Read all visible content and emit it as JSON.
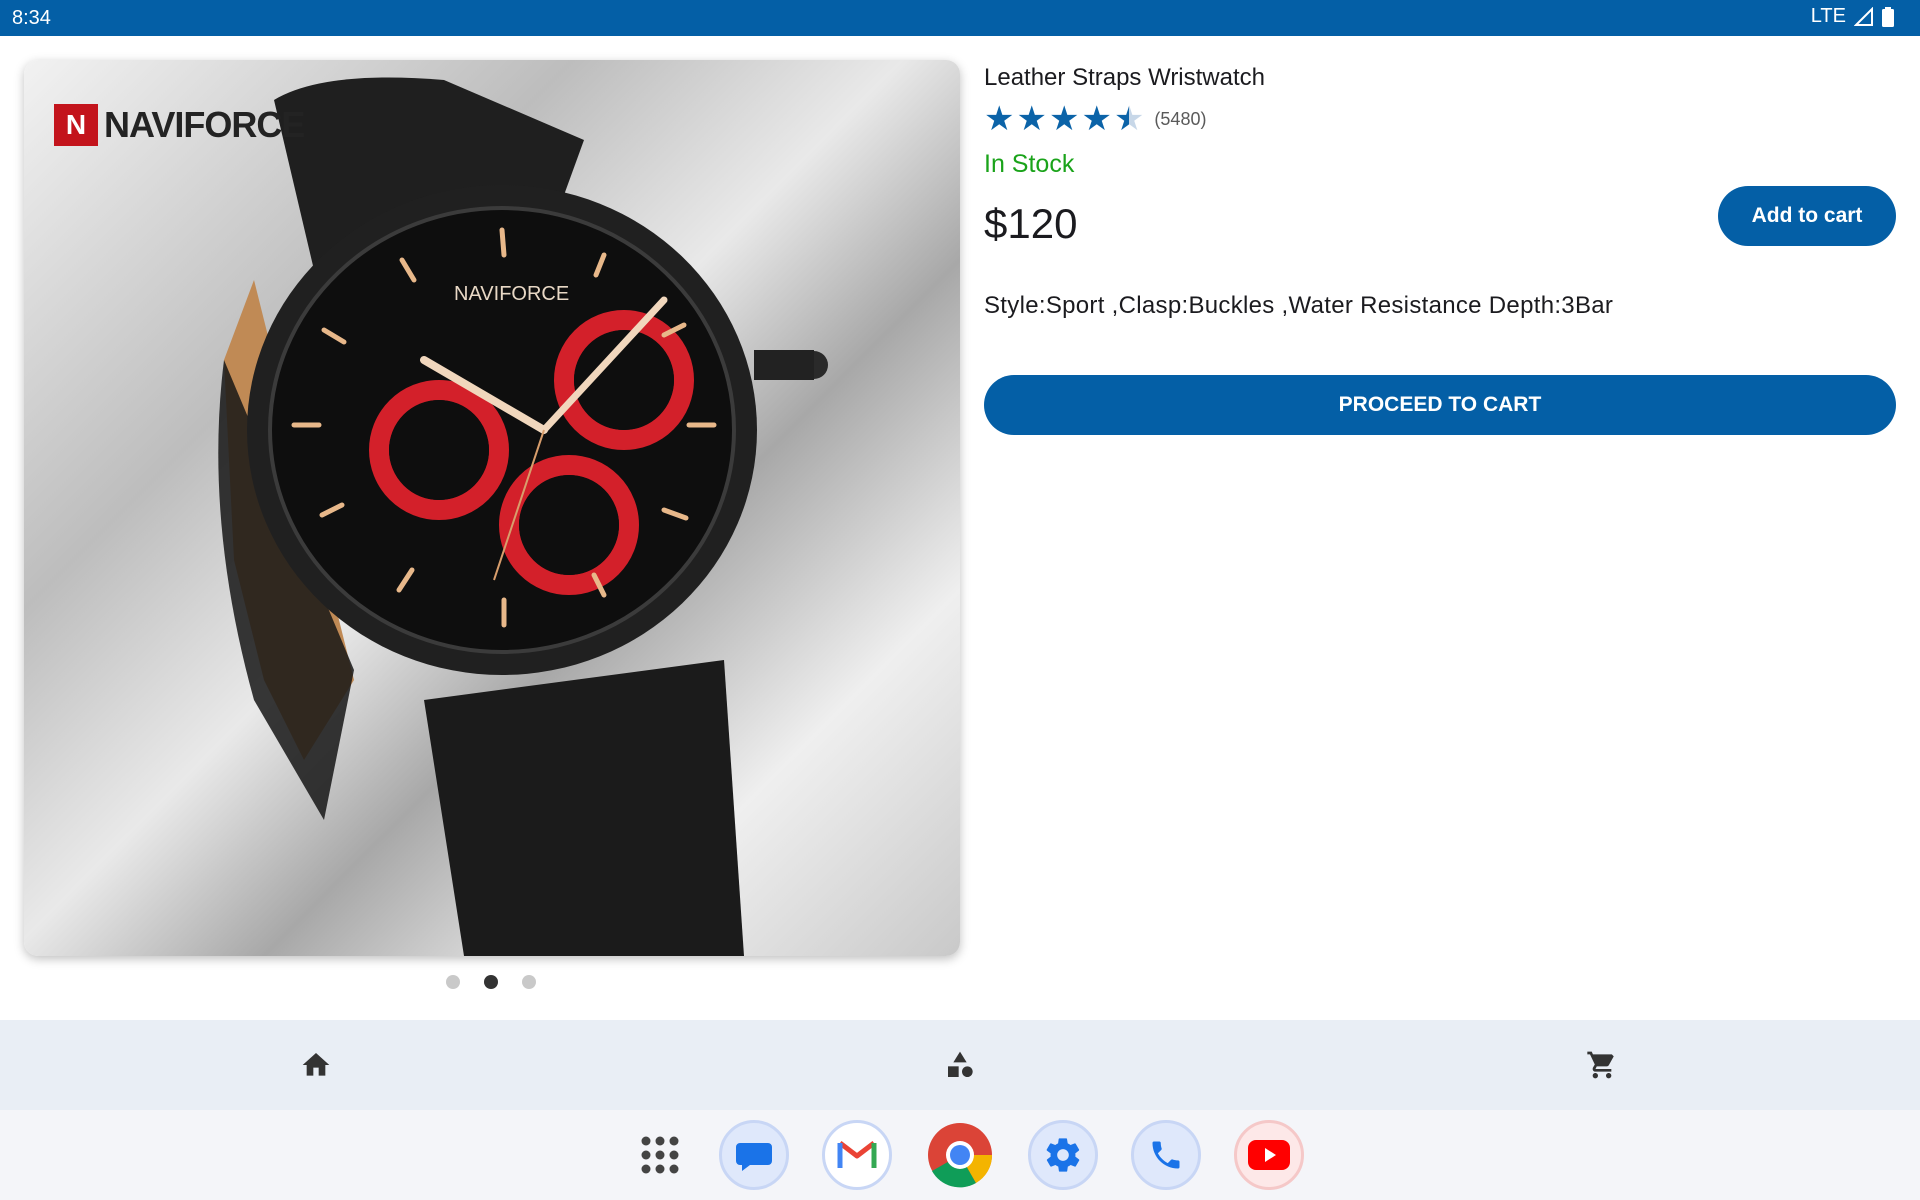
{
  "status_bar": {
    "time": "8:34",
    "network": "LTE",
    "icons": [
      "signal-icon",
      "battery-icon"
    ]
  },
  "product": {
    "image_brand": "NAVIFORCE",
    "title": "Leather Straps Wristwatch",
    "rating": 4.5,
    "rating_count": "(5480)",
    "stock": "In Stock",
    "price": "$120",
    "add_to_cart_label": "Add to cart",
    "description": "Style:Sport ,Clasp:Buckles ,Water Resistance Depth:3Bar",
    "proceed_label": "PROCEED TO CART",
    "carousel": {
      "total": 3,
      "active_index": 1
    }
  },
  "bottom_nav": {
    "items": [
      {
        "name": "home",
        "icon": "home-icon"
      },
      {
        "name": "categories",
        "icon": "categories-icon"
      },
      {
        "name": "cart",
        "icon": "cart-icon"
      }
    ]
  },
  "dock": {
    "apps": [
      "app-drawer-icon",
      "messages-icon",
      "gmail-icon",
      "chrome-icon",
      "settings-icon",
      "phone-icon",
      "youtube-icon"
    ]
  },
  "colors": {
    "primary": "#045fa6",
    "in_stock": "#1aa31a",
    "star": "#0b63a8"
  }
}
